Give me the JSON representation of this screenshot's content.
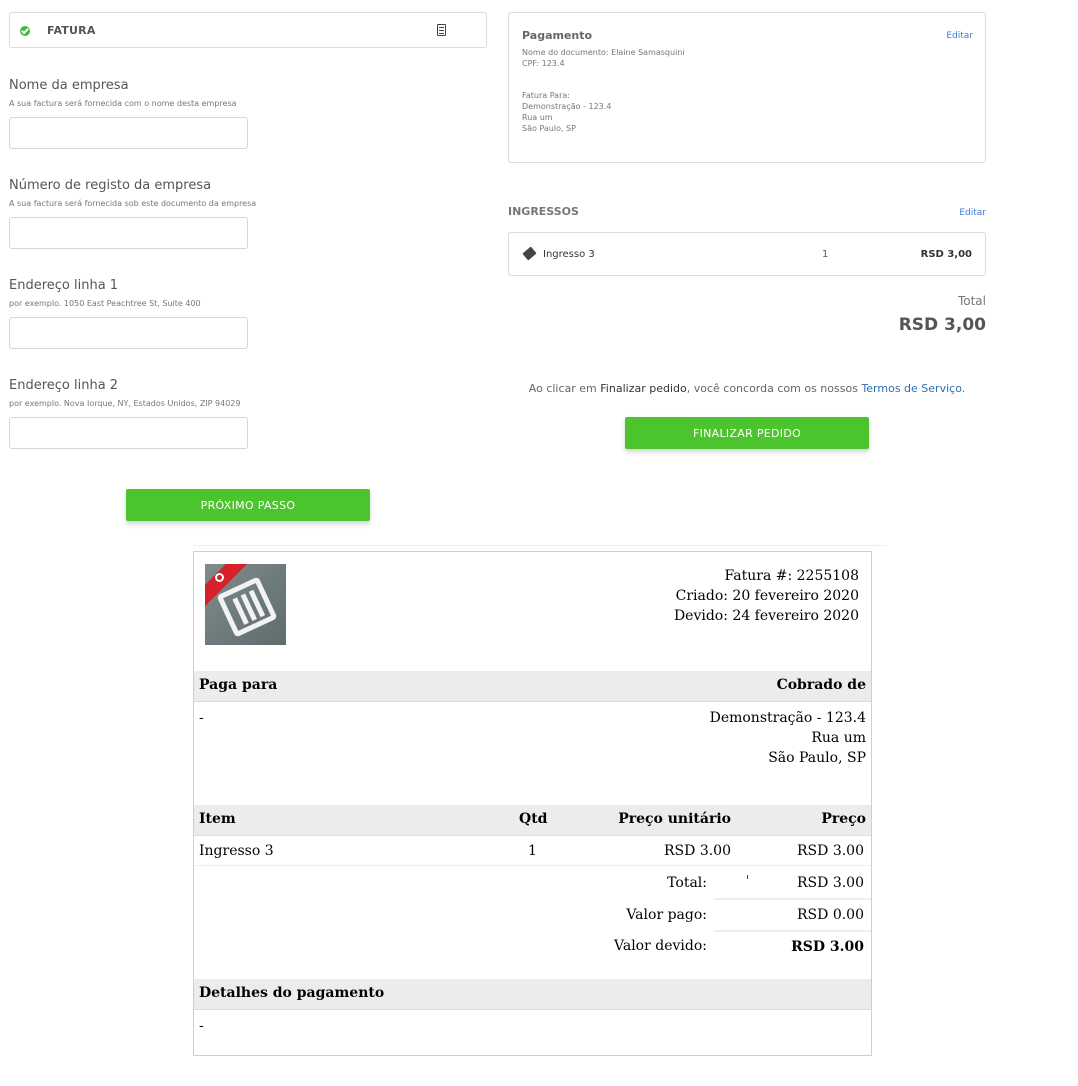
{
  "form": {
    "section_label": "FATURA",
    "fields": [
      {
        "title": "Nome da empresa",
        "hint": "A sua factura será fornecida com o nome desta empresa",
        "value": ""
      },
      {
        "title": "Número de registo da empresa",
        "hint": "A sua factura será fornecida sob este documento da empresa",
        "value": ""
      },
      {
        "title": "Endereço linha 1",
        "hint": "por exemplo. 1050 East Peachtree St, Suite 400",
        "value": ""
      },
      {
        "title": "Endereço linha 2",
        "hint": "por exemplo. Nova Iorque, NY, Estados Unidos, ZIP 94029",
        "value": ""
      }
    ],
    "next_button": "PRÓXIMO PASSO"
  },
  "payment": {
    "title": "Pagamento",
    "edit": "Editar",
    "doc_name": "Nome do documento: Elaine Samasquini",
    "cpf": "CPF: 123.4",
    "invoice_to_label": "Fatura Para:",
    "invoice_to_line1": "Demonstração - 123.4",
    "invoice_to_line2": "Rua um",
    "invoice_to_line3": "São Paulo, SP"
  },
  "tickets": {
    "title": "INGRESSOS",
    "edit": "Editar",
    "items": [
      {
        "name": "Ingresso 3",
        "qty": "1",
        "price": "RSD 3,00"
      }
    ],
    "total_label": "Total",
    "total_value": "RSD 3,00"
  },
  "terms": {
    "prefix": "Ao clicar em ",
    "action": "Finalizar pedido",
    "middle": ", você concorda com os nossos ",
    "link": "Termos de Serviço",
    "suffix": "."
  },
  "finalize_button": "FINALIZAR PEDIDO",
  "invoice": {
    "number": "Fatura #: 2255108",
    "created": "Criado: 20 fevereiro 2020",
    "due": "Devido: 24 fevereiro 2020",
    "pay_to_header": "Paga para",
    "billed_to_header": "Cobrado de",
    "pay_to_value": "-",
    "billed_line1": "Demonstração - 123.4",
    "billed_line2": "Rua um",
    "billed_line3": "São Paulo, SP",
    "col_item": "Item",
    "col_qty": "Qtd",
    "col_unit": "Preço unitário",
    "col_price": "Preço",
    "rows": [
      {
        "item": "Ingresso 3",
        "qty": "1",
        "unit": "RSD 3.00",
        "price": "RSD 3.00"
      }
    ],
    "total_label": "Total:",
    "total_value": "RSD 3.00",
    "paid_label": "Valor pago:",
    "paid_value": "RSD 0.00",
    "due_label": "Valor devido:",
    "due_value": "RSD 3.00",
    "payment_details_header": "Detalhes do pagamento",
    "payment_details_value": "-"
  },
  "colors": {
    "accent_green": "#4cc42e",
    "link_blue": "#3a7bd5",
    "logo_red": "#d8202a"
  }
}
